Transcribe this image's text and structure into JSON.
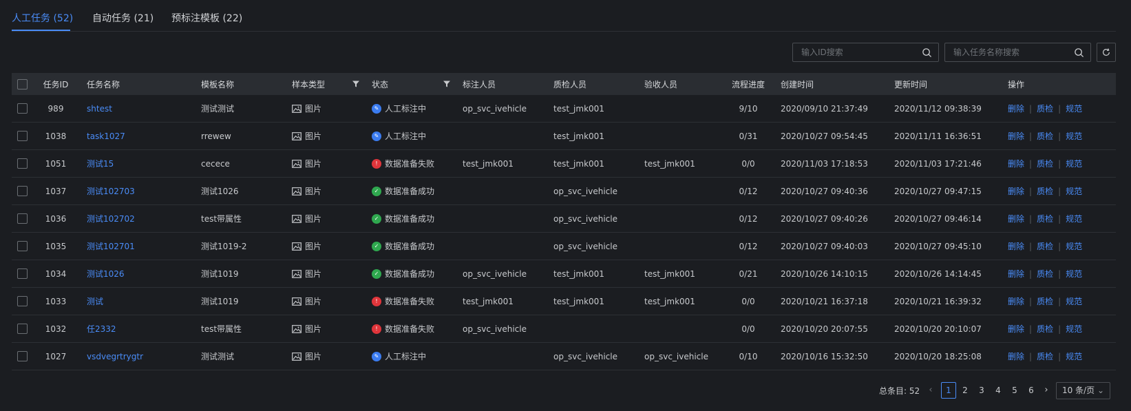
{
  "tabs": [
    {
      "label": "人工任务 (52)"
    },
    {
      "label": "自动任务 (21)"
    },
    {
      "label": "预标注模板 (22)"
    }
  ],
  "search": {
    "id_placeholder": "输入ID搜索",
    "name_placeholder": "输入任务名称搜索"
  },
  "colors": {
    "accent": "#4a8cf7",
    "status_labeling": "#3b7cf0",
    "status_fail": "#e0353b",
    "status_success": "#2fa84f"
  },
  "table": {
    "headers": {
      "id": "任务ID",
      "name": "任务名称",
      "template": "模板名称",
      "sample_type": "样本类型",
      "status": "状态",
      "annotator": "标注人员",
      "qa": "质检人员",
      "acceptor": "验收人员",
      "progress": "流程进度",
      "created": "创建时间",
      "updated": "更新时间",
      "actions": "操作"
    },
    "action_labels": {
      "delete": "删除",
      "qa": "质检",
      "spec": "规范"
    },
    "rows": [
      {
        "id": "989",
        "name": "shtest",
        "template": "测试测试",
        "sample_type": "图片",
        "status": "人工标注中",
        "status_kind": "labeling",
        "annotator": "op_svc_ivehicle",
        "qa": "test_jmk001",
        "acceptor": "",
        "progress": "9/10",
        "created": "2020/09/10 21:37:49",
        "updated": "2020/11/12 09:38:39"
      },
      {
        "id": "1038",
        "name": "task1027",
        "template": "rrewew",
        "sample_type": "图片",
        "status": "人工标注中",
        "status_kind": "labeling",
        "annotator": "",
        "qa": "test_jmk001",
        "acceptor": "",
        "progress": "0/31",
        "created": "2020/10/27 09:54:45",
        "updated": "2020/11/11 16:36:51"
      },
      {
        "id": "1051",
        "name": "测试15",
        "template": "cecece",
        "sample_type": "图片",
        "status": "数据准备失败",
        "status_kind": "fail",
        "annotator": "test_jmk001",
        "qa": "test_jmk001",
        "acceptor": "test_jmk001",
        "progress": "0/0",
        "created": "2020/11/03 17:18:53",
        "updated": "2020/11/03 17:21:46"
      },
      {
        "id": "1037",
        "name": "测试102703",
        "template": "测试1026",
        "sample_type": "图片",
        "status": "数据准备成功",
        "status_kind": "success",
        "annotator": "",
        "qa": "op_svc_ivehicle",
        "acceptor": "",
        "progress": "0/12",
        "created": "2020/10/27 09:40:36",
        "updated": "2020/10/27 09:47:15"
      },
      {
        "id": "1036",
        "name": "测试102702",
        "template": "test带属性",
        "sample_type": "图片",
        "status": "数据准备成功",
        "status_kind": "success",
        "annotator": "",
        "qa": "op_svc_ivehicle",
        "acceptor": "",
        "progress": "0/12",
        "created": "2020/10/27 09:40:26",
        "updated": "2020/10/27 09:46:14"
      },
      {
        "id": "1035",
        "name": "测试102701",
        "template": "测试1019-2",
        "sample_type": "图片",
        "status": "数据准备成功",
        "status_kind": "success",
        "annotator": "",
        "qa": "op_svc_ivehicle",
        "acceptor": "",
        "progress": "0/12",
        "created": "2020/10/27 09:40:03",
        "updated": "2020/10/27 09:45:10"
      },
      {
        "id": "1034",
        "name": "测试1026",
        "template": "测试1019",
        "sample_type": "图片",
        "status": "数据准备成功",
        "status_kind": "success",
        "annotator": "op_svc_ivehicle",
        "qa": "test_jmk001",
        "acceptor": "test_jmk001",
        "progress": "0/21",
        "created": "2020/10/26 14:10:15",
        "updated": "2020/10/26 14:14:45"
      },
      {
        "id": "1033",
        "name": "测试",
        "template": "测试1019",
        "sample_type": "图片",
        "status": "数据准备失败",
        "status_kind": "fail",
        "annotator": "test_jmk001",
        "qa": "test_jmk001",
        "acceptor": "test_jmk001",
        "progress": "0/0",
        "created": "2020/10/21 16:37:18",
        "updated": "2020/10/21 16:39:32"
      },
      {
        "id": "1032",
        "name": "任2332",
        "template": "test带属性",
        "sample_type": "图片",
        "status": "数据准备失败",
        "status_kind": "fail",
        "annotator": "op_svc_ivehicle",
        "qa": "",
        "acceptor": "",
        "progress": "0/0",
        "created": "2020/10/20 20:07:55",
        "updated": "2020/10/20 20:10:07"
      },
      {
        "id": "1027",
        "name": "vsdvegrtrygtr",
        "template": "测试测试",
        "sample_type": "图片",
        "status": "人工标注中",
        "status_kind": "labeling",
        "annotator": "",
        "qa": "op_svc_ivehicle",
        "acceptor": "op_svc_ivehicle",
        "progress": "0/10",
        "created": "2020/10/16 15:32:50",
        "updated": "2020/10/20 18:25:08"
      }
    ]
  },
  "pagination": {
    "total_label": "总条目: 52",
    "pages": [
      "1",
      "2",
      "3",
      "4",
      "5",
      "6"
    ],
    "current": "1",
    "page_size": "10 条/页"
  }
}
